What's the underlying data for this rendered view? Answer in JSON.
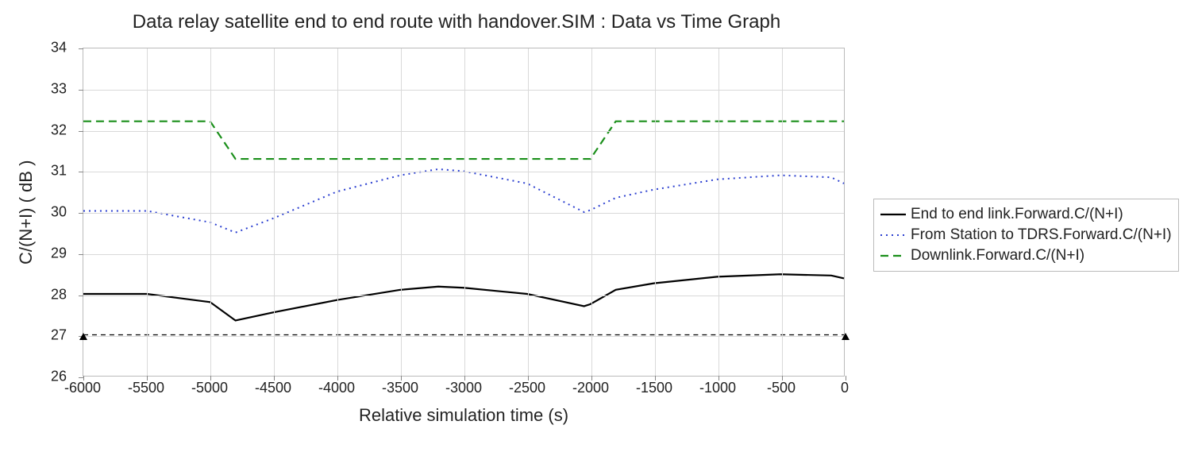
{
  "chart_data": {
    "type": "line",
    "title": "Data relay satellite end to end route with handover.SIM : Data vs Time Graph",
    "xlabel": "Relative simulation time (s)",
    "ylabel": "C/(N+I) ( dB )",
    "xlim": [
      -6000,
      0
    ],
    "ylim": [
      26,
      34
    ],
    "x_ticks": [
      -6000,
      -5500,
      -5000,
      -4500,
      -4000,
      -3500,
      -3000,
      -2500,
      -2000,
      -1500,
      -1000,
      -500,
      0
    ],
    "y_ticks": [
      26,
      27,
      28,
      29,
      30,
      31,
      32,
      33,
      34
    ],
    "grid": true,
    "x": [
      -6000,
      -5500,
      -5000,
      -4800,
      -4500,
      -4000,
      -3500,
      -3200,
      -3000,
      -2500,
      -2050,
      -2000,
      -1800,
      -1500,
      -1000,
      -500,
      -100,
      0
    ],
    "series": [
      {
        "name": "End to end link.Forward.C/(N+I)",
        "style": "solid",
        "color": "#000000",
        "values": [
          28.0,
          28.0,
          27.8,
          27.35,
          27.55,
          27.85,
          28.1,
          28.18,
          28.15,
          28.0,
          27.7,
          27.75,
          28.1,
          28.26,
          28.42,
          28.48,
          28.45,
          28.38
        ]
      },
      {
        "name": "From Station to TDRS.Forward.C/(N+I)",
        "style": "dotted",
        "color": "#2b3fd0",
        "values": [
          30.03,
          30.03,
          29.75,
          29.5,
          29.85,
          30.5,
          30.9,
          31.05,
          31.0,
          30.7,
          30.0,
          30.05,
          30.35,
          30.55,
          30.8,
          30.9,
          30.85,
          30.7
        ]
      },
      {
        "name": "Downlink.Forward.C/(N+I)",
        "style": "dashed",
        "color": "#1a8f1a",
        "values": [
          32.22,
          32.22,
          32.22,
          31.3,
          31.3,
          31.3,
          31.3,
          31.3,
          31.3,
          31.3,
          31.3,
          31.3,
          32.22,
          32.22,
          32.22,
          32.22,
          32.22,
          32.22
        ]
      }
    ],
    "reference_line": {
      "y": 27.0,
      "style": "dashed-thin",
      "color": "#000000",
      "markers": "triangle-ends"
    },
    "legend_position": "right"
  }
}
